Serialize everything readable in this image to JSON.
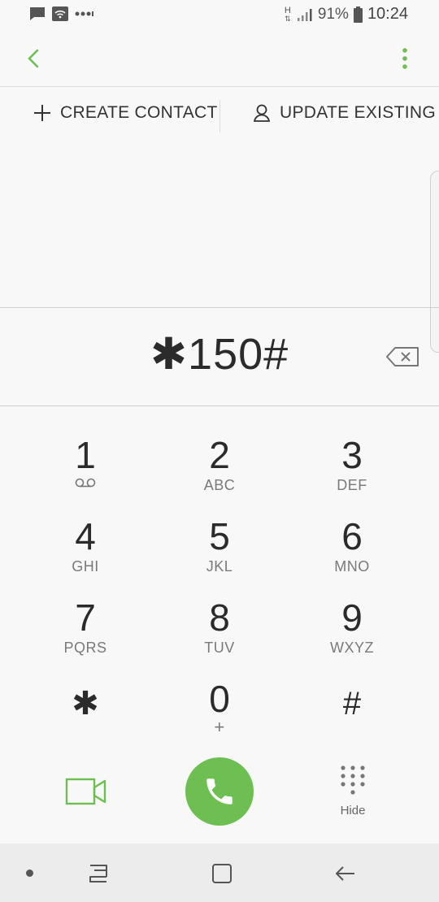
{
  "status_bar": {
    "battery": "91%",
    "time": "10:24",
    "network_type": "H",
    "icons": [
      "message-icon",
      "wifi-icon",
      "more-notifications-icon",
      "network-h-icon",
      "signal-icon",
      "battery-icon"
    ]
  },
  "header": {
    "back_icon": "chevron-left-icon",
    "menu_icon": "more-vert-icon"
  },
  "actions": {
    "create_label": "CREATE CONTACT",
    "update_label": "UPDATE EXISTING"
  },
  "dialer": {
    "number": "✱150#"
  },
  "keypad": {
    "keys": [
      {
        "digit": "1",
        "letters": ""
      },
      {
        "digit": "2",
        "letters": "ABC"
      },
      {
        "digit": "3",
        "letters": "DEF"
      },
      {
        "digit": "4",
        "letters": "GHI"
      },
      {
        "digit": "5",
        "letters": "JKL"
      },
      {
        "digit": "6",
        "letters": "MNO"
      },
      {
        "digit": "7",
        "letters": "PQRS"
      },
      {
        "digit": "8",
        "letters": "TUV"
      },
      {
        "digit": "9",
        "letters": "WXYZ"
      },
      {
        "digit": "✱",
        "letters": ""
      },
      {
        "digit": "0",
        "letters": "+"
      },
      {
        "digit": "#",
        "letters": ""
      }
    ]
  },
  "bottom": {
    "hide_label": "Hide"
  },
  "colors": {
    "accent": "#6cbf50",
    "background": "#f8f8f8",
    "navbar": "#ececec"
  }
}
